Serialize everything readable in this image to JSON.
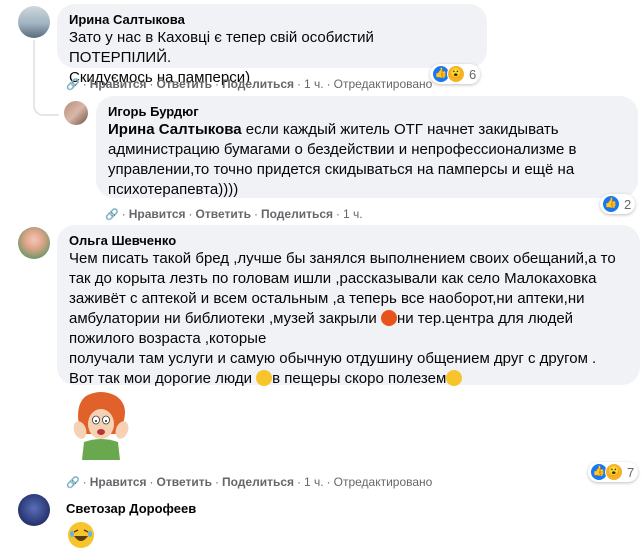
{
  "comments": [
    {
      "author": "Ирина Салтыкова",
      "lines": [
        "Зато у нас в Каховці є тепер свій особистий ПОТЕРПІЛИЙ.",
        "Скидуємось на памперси)"
      ],
      "actions": {
        "like": "Нравится",
        "reply": "Ответить",
        "share": "Поделиться",
        "time": "1 ч.",
        "edited": "Отредактировано"
      },
      "reactions": {
        "icons": [
          "like-icon",
          "wow-icon"
        ],
        "count": "6"
      }
    },
    {
      "author": "Игорь Бурдюг",
      "mention": "Ирина Салтыкова",
      "lines": [
        " если каждый житель ОТГ начнет закидывать",
        "администрацию бумагами о бездействии и непрофессионализме в",
        "управлении,то точно придется скидываться на памперсы и ещё на",
        "психотерапевта))))"
      ],
      "actions": {
        "like": "Нравится",
        "reply": "Ответить",
        "share": "Поделиться",
        "time": "1 ч."
      },
      "reactions": {
        "icons": [
          "like-icon"
        ],
        "count": "2"
      }
    },
    {
      "author": "Ольга Шевченко",
      "lines": [
        "Чем писать такой бред ,лучше бы занялся выполнением своих обещаний,а то",
        "так до корыта лезть по головам ишли ,рассказывали как село Малокаховка",
        "заживёт с аптекой и всем остальным ,а теперь все наоборот,ни аптеки,ни",
        "амбулатории ни библиотеки ,музей закрыли",
        "ни тер.центра для людей",
        "пожилого возраста ,которые",
        "получали там услуги и самую обычную отдушину общением друг с другом .",
        "Вот так мои дорогие люди",
        "в пещеры скоро полезем"
      ],
      "actions": {
        "like": "Нравится",
        "reply": "Ответить",
        "share": "Поделиться",
        "time": "1 ч.",
        "edited": "Отредактировано"
      },
      "reactions": {
        "icons": [
          "like-icon",
          "wow-icon"
        ],
        "count": "7"
      }
    },
    {
      "author": "Светозар Дорофеев"
    }
  ],
  "colors": {
    "bubble": "#f0f2f5",
    "like": "#1877f2",
    "secondary": "#65676b"
  }
}
